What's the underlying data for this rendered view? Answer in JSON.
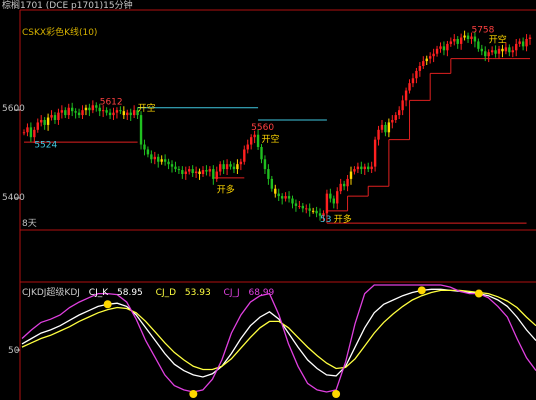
{
  "window": {
    "title": "棕榈1701 (DCE p1701)15分钟"
  },
  "price_panel": {
    "indicator_title": "CSKX彩色K线(10)",
    "period_label": "8天",
    "y_ticks": [
      "5600",
      "5400"
    ]
  },
  "kdj_panel": {
    "indicator_name": "CJKDJ超级KDJ",
    "k_label": "CJ_K",
    "k_value": "58.95",
    "d_label": "CJ_D",
    "d_value": "53.93",
    "j_label": "CJ_J",
    "j_value": "68.99",
    "y_ticks": [
      "50"
    ]
  },
  "colors": {
    "background": "#000000",
    "up_candle": "#ff2020",
    "down_candle": "#20c020",
    "neutral_candle": "#ffd700",
    "stop_line_long": "#e02020",
    "stop_line_short": "#40c8e0",
    "panel_border": "#b01010",
    "k_line": "#ffffff",
    "d_line": "#ffff40",
    "j_line": "#e040e0",
    "marker": "#ffd700"
  },
  "chart_data": [
    {
      "type": "candlestick",
      "title": "CSKX彩色K线(10)",
      "ylim": [
        5360,
        5800
      ],
      "y_ticks": [
        5600,
        5400
      ],
      "annotations": [
        {
          "text": "5612",
          "x_index": 22,
          "y": 5612,
          "color": "#ff4040"
        },
        {
          "text": "5524",
          "x_index": 3,
          "y": 5524,
          "color": "#40c8e0"
        },
        {
          "text": "开空",
          "x_index": 33,
          "y": 5598,
          "color": "#ffd700"
        },
        {
          "text": "5560",
          "x_index": 66,
          "y": 5560,
          "color": "#ff4040"
        },
        {
          "text": "开空",
          "x_index": 69,
          "y": 5535,
          "color": "#ffd700"
        },
        {
          "text": "开多",
          "x_index": 56,
          "y": 5432,
          "color": "#ffd700"
        },
        {
          "text": "53",
          "x_index": 86,
          "y": 5372,
          "color": "#40c8e0"
        },
        {
          "text": "开多",
          "x_index": 90,
          "y": 5372,
          "color": "#ffd700"
        },
        {
          "text": "5758",
          "x_index": 130,
          "y": 5758,
          "color": "#ff4040"
        },
        {
          "text": "开空",
          "x_index": 135,
          "y": 5738,
          "color": "#ffd700"
        }
      ],
      "closes": [
        5555,
        5565,
        5545,
        5560,
        5575,
        5580,
        5570,
        5585,
        5590,
        5580,
        5595,
        5600,
        5590,
        5605,
        5598,
        5595,
        5590,
        5600,
        5605,
        5600,
        5610,
        5605,
        5598,
        5600,
        5595,
        5590,
        5595,
        5600,
        5598,
        5590,
        5595,
        5590,
        5600,
        5590,
        5530,
        5520,
        5510,
        5500,
        5505,
        5495,
        5500,
        5495,
        5490,
        5485,
        5480,
        5478,
        5470,
        5475,
        5480,
        5472,
        5475,
        5470,
        5478,
        5475,
        5480,
        5460,
        5475,
        5490,
        5480,
        5490,
        5485,
        5480,
        5490,
        5495,
        5520,
        5530,
        5545,
        5550,
        5525,
        5500,
        5480,
        5460,
        5440,
        5430,
        5425,
        5420,
        5425,
        5420,
        5410,
        5405,
        5405,
        5400,
        5400,
        5395,
        5395,
        5390,
        5385,
        5390,
        5430,
        5420,
        5410,
        5435,
        5450,
        5445,
        5460,
        5475,
        5480,
        5485,
        5480,
        5485,
        5480,
        5485,
        5540,
        5560,
        5570,
        5555,
        5575,
        5580,
        5590,
        5600,
        5620,
        5640,
        5655,
        5665,
        5680,
        5690,
        5700,
        5705,
        5710,
        5715,
        5725,
        5730,
        5722,
        5735,
        5740,
        5745,
        5735,
        5748,
        5752,
        5745,
        5750,
        5740,
        5725,
        5720,
        5710,
        5718,
        5722,
        5715,
        5725,
        5720,
        5728,
        5718,
        5722,
        5735,
        5740,
        5730,
        5745,
        5748
      ],
      "stop_line": [
        {
          "from": 0,
          "to": 33,
          "side": "long",
          "level": 5535
        },
        {
          "from": 33,
          "to": 68,
          "side": "short",
          "level": 5605
        },
        {
          "from": 55,
          "to": 64,
          "side": "long",
          "level": 5462
        },
        {
          "from": 68,
          "to": 88,
          "side": "short",
          "level": 5580
        },
        {
          "from": 88,
          "to": 146,
          "side": "long",
          "level": 5370
        }
      ]
    },
    {
      "type": "line",
      "title": "CJKDJ超级KDJ",
      "ylim": [
        0,
        100
      ],
      "y_ticks": [
        50
      ],
      "series": [
        {
          "name": "CJ_K",
          "color": "#ffffff",
          "values": [
            45,
            50,
            55,
            58,
            62,
            67,
            72,
            76,
            80,
            82,
            83,
            80,
            72,
            60,
            48,
            36,
            26,
            20,
            16,
            14,
            17,
            24,
            36,
            50,
            62,
            70,
            75,
            68,
            55,
            42,
            30,
            22,
            16,
            15,
            24,
            42,
            60,
            74,
            82,
            86,
            90,
            93,
            95,
            96,
            96,
            95,
            94,
            93,
            92,
            90,
            86,
            80,
            70,
            58,
            48
          ]
        },
        {
          "name": "CJ_D",
          "color": "#ffff40",
          "values": [
            42,
            46,
            50,
            53,
            57,
            61,
            66,
            70,
            74,
            77,
            79,
            78,
            74,
            66,
            56,
            46,
            37,
            30,
            24,
            21,
            21,
            24,
            31,
            41,
            51,
            60,
            66,
            66,
            60,
            51,
            42,
            34,
            27,
            22,
            23,
            31,
            43,
            55,
            65,
            73,
            80,
            86,
            90,
            93,
            95,
            95,
            95,
            94,
            93,
            92,
            89,
            85,
            79,
            70,
            62
          ]
        },
        {
          "name": "CJ_J",
          "color": "#e040e0",
          "values": [
            50,
            58,
            65,
            68,
            72,
            79,
            84,
            88,
            92,
            92,
            91,
            84,
            68,
            48,
            32,
            16,
            6,
            2,
            0,
            2,
            12,
            30,
            55,
            72,
            84,
            90,
            92,
            72,
            45,
            24,
            8,
            2,
            0,
            2,
            28,
            64,
            92,
            100,
            100,
            100,
            100,
            100,
            100,
            100,
            100,
            98,
            94,
            92,
            92,
            88,
            80,
            70,
            50,
            32,
            20
          ]
        }
      ],
      "markers": [
        {
          "series": "CJ_K",
          "x_index": 9,
          "kind": "peak"
        },
        {
          "series": "CJ_K",
          "x_index": 18,
          "kind": "trough"
        },
        {
          "series": "CJ_K",
          "x_index": 33,
          "kind": "trough"
        },
        {
          "series": "CJ_K",
          "x_index": 42,
          "kind": "peak"
        },
        {
          "series": "CJ_K",
          "x_index": 48,
          "kind": "peak"
        }
      ]
    }
  ]
}
